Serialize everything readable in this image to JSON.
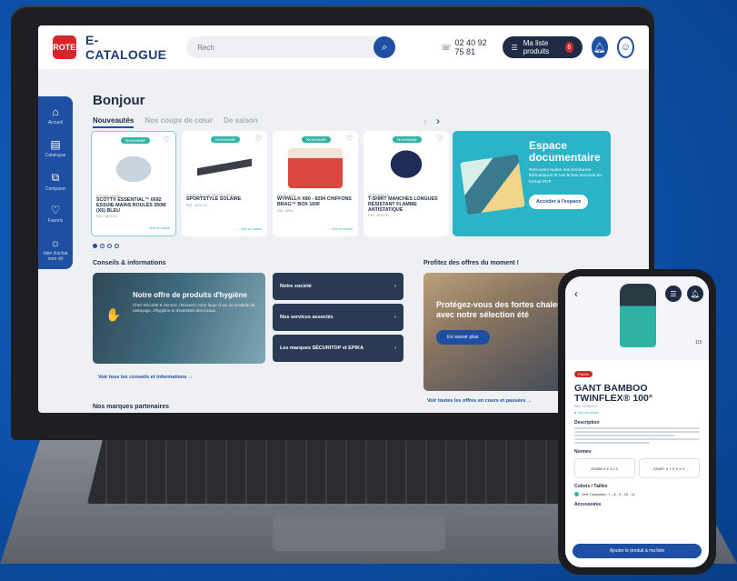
{
  "header": {
    "brand": "E-CATALOGUE",
    "logo_text": "PROTEC",
    "search_placeholder": "Rech",
    "phone": "02 40 92 75 81",
    "list_label": "Ma liste produits",
    "list_count": "6"
  },
  "sidebar": {
    "items": [
      {
        "label": "Accueil",
        "icon": "home-icon"
      },
      {
        "label": "Catalogue",
        "icon": "catalog-icon"
      },
      {
        "label": "Comparer",
        "icon": "compare-icon"
      },
      {
        "label": "Favoris",
        "icon": "heart-icon"
      },
      {
        "label": "Idée d'achat mon rêt",
        "icon": "lightbulb-icon"
      }
    ]
  },
  "main": {
    "greeting": "Bonjour",
    "tabs": [
      "Nouveautés",
      "Nos coups de cœur",
      "De saison"
    ],
    "products": [
      {
        "badge": "Nouveauté",
        "category": "ESSUIE-MAINS",
        "name": "SCOTT® ESSENTIAL™ 6692 ESSUIE-MAINS ROULÉS 350M (X6) BLEU",
        "ref": "Réf : 1675-01",
        "link": "→ Voir en stock"
      },
      {
        "badge": "Nouveauté",
        "category": "LUNETTES DE PROTECTION",
        "name": "SPORTSTYLE SOLAIRE",
        "ref": "Réf : 1675-01",
        "link": "→ Voir en stock"
      },
      {
        "badge": "Nouveauté",
        "category": "ESSUYAGE",
        "name": "WYPALL® X80 - 8294 CHIFFONS BRAG™ BOX 160F",
        "ref": "Réf : 8294",
        "link": "→ Voir en stock"
      },
      {
        "badge": "Nouveauté",
        "category": "VÊTEMENTS",
        "name": "T-SHIRT MANCHES LONGUES RÉSISTANT FLAMME ANTISTATIQUE",
        "ref": "Réf : 1675-01",
        "link": ""
      }
    ],
    "espace": {
      "title": "Espace documentaire",
      "text": "Retrouvez toutes nos brochures thématiques et nos fiches services au format PDF",
      "button": "Accéder à l'espace"
    },
    "advice": {
      "section_title": "Conseils & informations",
      "card_title": "Notre offre de produits d'hygiène",
      "card_text": "Chez Sécurité & Service, retrouvez notre large choix de produits de nettoyage, d'hygiène et d'entretien des locaux.",
      "menu": [
        "Notre société",
        "Nos services associés",
        "Les marques SÉCURITOP et EPIKA"
      ],
      "link": "Voir tous les conseils et informations →"
    },
    "offers": {
      "section_title": "Profitez des offres du moment !",
      "card_title": "Protégez-vous des fortes chaleurs avec notre sélection été",
      "button": "En savoir plus",
      "link": "Voir toutes les offres en cours et passées →"
    },
    "partners_title": "Nos marques partenaires"
  },
  "phone": {
    "badge": "Promo",
    "title": "GANT BAMBOO TWINFLEX® 100°",
    "ref": "Réf : 0105724",
    "stock": "● Voir en stock",
    "description_h": "Description",
    "norms_h": "Normes",
    "norm1": "EN388 4 X 4 1 C",
    "norm2": "EN407 X 1 X X X X",
    "colors_h": "Coloris / Tailles",
    "color_value": "Vert-Turquoise / 7 - 8 - 9 - 10 - 11",
    "accessories_h": "Accessoires",
    "cta": "Ajouter le produit à ma liste",
    "pager": "1/3"
  },
  "colors": {
    "background": "#0b4fa6",
    "primary": "#1f4fa3",
    "accent": "#2fb3a4",
    "brand_red": "#d7262b",
    "dark": "#1f2b45"
  }
}
